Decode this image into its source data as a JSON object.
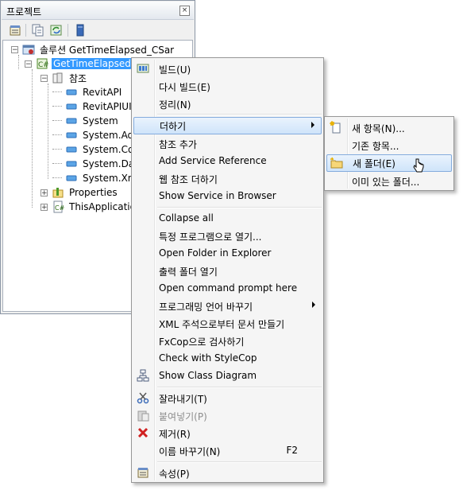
{
  "panel": {
    "title": "프로젝트",
    "close_glyph": "×",
    "toolbar": [
      "properties-icon",
      "show-all-files-icon",
      "refresh-icon",
      "view-class-diagram-icon"
    ]
  },
  "tree": {
    "solution": "솔루션 GetTimeElapsed_CSar",
    "project": "GetTimeElapsed_C",
    "references": "참조",
    "refs": [
      "RevitAPI",
      "RevitAPIUI",
      "System",
      "System.Ad",
      "System.Co",
      "System.Da",
      "System.Xm"
    ],
    "properties": "Properties",
    "this_application": "ThisApplication"
  },
  "context_menu": {
    "items": [
      {
        "label": "빌드(U)",
        "icon": "build-icon"
      },
      {
        "label": "다시 빌드(E)"
      },
      {
        "label": "정리(N)"
      },
      {
        "label": "더하기",
        "submenu": true,
        "hover": true
      },
      {
        "label": "참조 추가"
      },
      {
        "label": "Add Service Reference"
      },
      {
        "label": "웹 참조 더하기"
      },
      {
        "label": "Show Service in Browser"
      },
      {
        "label": "Collapse all"
      },
      {
        "label": "특정 프로그램으로 열기..."
      },
      {
        "label": "Open Folder in Explorer"
      },
      {
        "label": "출력 폴더 열기"
      },
      {
        "label": "Open command prompt here"
      },
      {
        "label": "프로그래밍 언어 바꾸기",
        "submenu": true
      },
      {
        "label": "XML 주석으로부터 문서 만들기"
      },
      {
        "label": "FxCop으로 검사하기"
      },
      {
        "label": "Check with StyleCop"
      },
      {
        "label": "Show Class Diagram",
        "icon": "class-diagram-icon"
      },
      {
        "label": "잘라내기(T)",
        "icon": "cut-icon"
      },
      {
        "label": "붙여넣기(P)",
        "icon": "paste-icon",
        "disabled": true
      },
      {
        "label": "제거(R)",
        "icon": "delete-icon"
      },
      {
        "label": "이름 바꾸기(N)",
        "shortcut": "F2"
      },
      {
        "label": "속성(P)",
        "icon": "properties-icon"
      }
    ]
  },
  "submenu": {
    "items": [
      {
        "label": "새 항목(N)...",
        "icon": "new-item-icon"
      },
      {
        "label": "기존 항목..."
      },
      {
        "label": "새 폴더(E)",
        "icon": "new-folder-icon",
        "hover": true
      },
      {
        "label": "이미 있는 폴더..."
      }
    ]
  },
  "colors": {
    "selection": "#3399ff",
    "menu_hover_border": "#84acdd",
    "menu_bg": "#f5f5f5"
  }
}
